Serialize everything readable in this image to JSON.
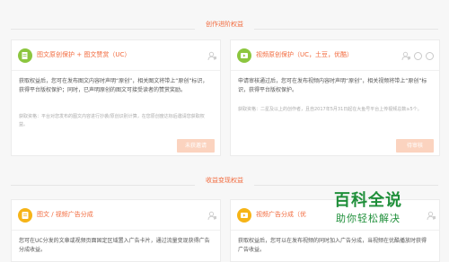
{
  "sections": {
    "top_title": "创作进阶权益",
    "bottom_title": "收益变现权益"
  },
  "cards": [
    {
      "title": "图文原创保护 + 图文赞赏（UC）",
      "desc": "获取权益后，您可在发布图文内容时声明“原创”，相关图文将带上“原创”标识，获得平台版权保护；同时，已声明原创的图文可接受读者的赞赏奖励。",
      "note": "获取资格：平台对您发布的图文内容进行抄袭/原创识别计算，在您原创度达标后邀请您获取权益。",
      "button": "未获邀请"
    },
    {
      "title": "视频原创保护（UC，土豆，优酷）",
      "desc": "申请审核通过后，您可在发布视频内容时声明“原创”，相关视频将带上“原创”标识，获得平台版权保护。",
      "note": "获取资格：二星及以上的创作者，且自2017年5月31日起在大鱼号平台上传视频总数≥5个。",
      "button": "待审核"
    },
    {
      "title": "图文 / 视频广告分成",
      "desc": "您可在UC分发的文章或视频页面固定区域置入广告卡片，通过流量变现获得广告分成收益。"
    },
    {
      "title": "视频广告分成（优",
      "desc": "获取权益后，您可以在发布视频的同时加入广告分成，当视频在优酷播放时获得广告收益。"
    }
  ],
  "colors": {
    "accent": "#f26a3d",
    "green_badge": "#8cc63f",
    "yellow_badge": "#f6b417",
    "button_disabled": "#fbd3bf"
  },
  "icons": {
    "card1": "document-shield-icon",
    "card2": "video-shield-icon",
    "card3": "document-ad-icon",
    "card4": "video-ad-icon"
  },
  "watermark": {
    "main": "百科全说",
    "sub": "助你轻松解决"
  }
}
